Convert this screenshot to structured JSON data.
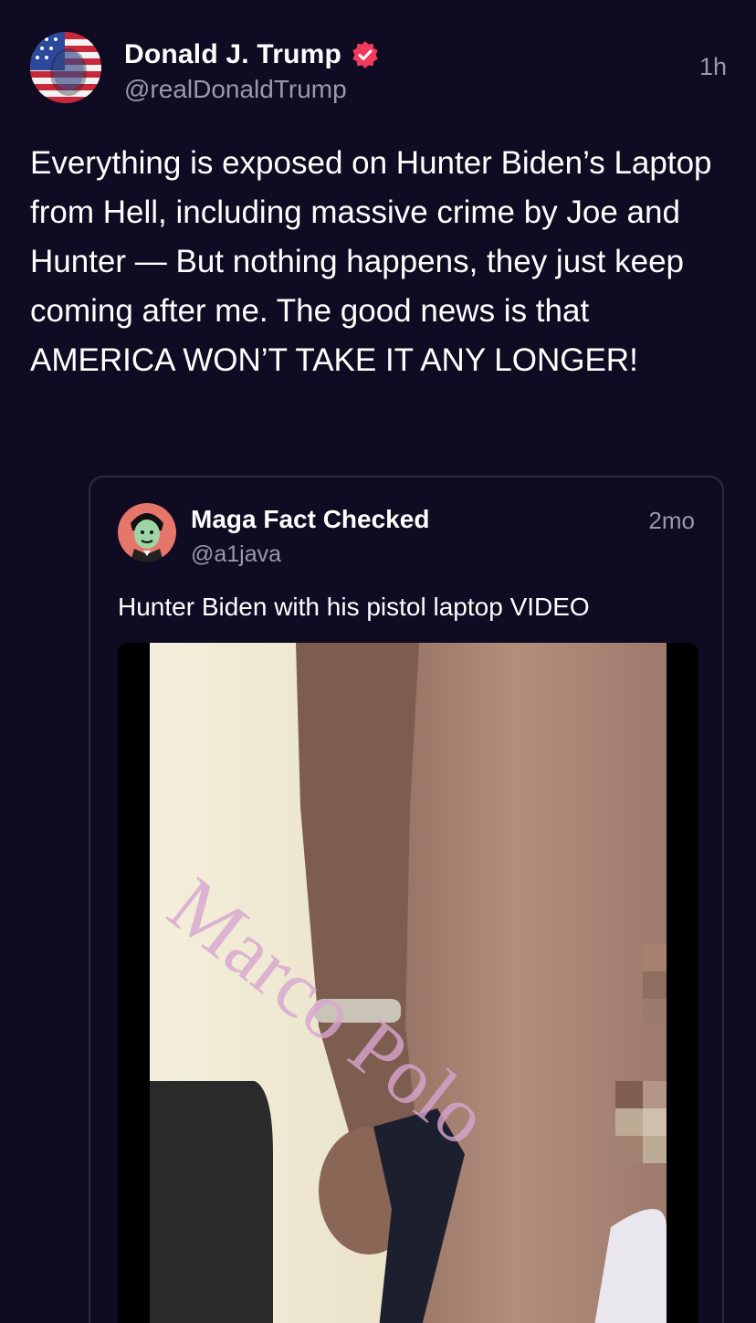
{
  "post": {
    "author_name": "Donald J. Trump",
    "author_handle": "@realDonaldTrump",
    "timestamp": "1h",
    "text": "Everything is exposed on Hunter Biden’s Laptop from Hell, including massive crime by Joe and Hunter — But nothing happens, they just keep coming after me. The good news is that AMERICA WON’T TAKE IT ANY LONGER!",
    "verified_icon": "verified-check-icon",
    "verified_color": "#ef3b5c"
  },
  "quoted_post": {
    "author_name": "Maga Fact Checked",
    "author_handle": "@a1java",
    "timestamp": "2mo",
    "text": "Hunter Biden with his pistol laptop VIDEO",
    "media_watermark": "Marco Polo",
    "media_icon": "video-thumbnail"
  },
  "colors": {
    "background": "#0e0b22",
    "text_primary": "#ffffff",
    "text_secondary": "#9b98ad",
    "card_border": "#2c2942"
  }
}
